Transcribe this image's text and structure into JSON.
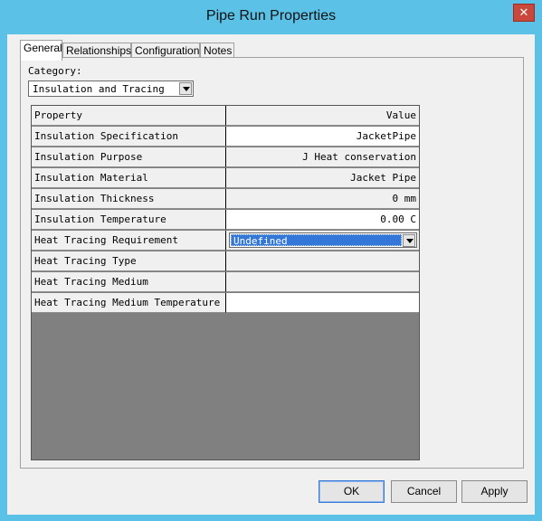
{
  "window": {
    "title": "Pipe Run Properties",
    "close_glyph": "✕"
  },
  "tabs": [
    {
      "label": "General"
    },
    {
      "label": "Relationships"
    },
    {
      "label": "Configuration"
    },
    {
      "label": "Notes"
    }
  ],
  "category": {
    "label": "Category:",
    "selected": "Insulation and Tracing"
  },
  "grid": {
    "header": {
      "property": "Property",
      "value": "Value"
    },
    "rows": [
      {
        "name": "Insulation Specification",
        "value": "JacketPipe"
      },
      {
        "name": "Insulation Purpose",
        "value": "J Heat conservation"
      },
      {
        "name": "Insulation Material",
        "value": "Jacket Pipe"
      },
      {
        "name": "Insulation Thickness",
        "value": "0 mm"
      },
      {
        "name": "Insulation Temperature",
        "value": "0.00 C"
      },
      {
        "name": "Heat Tracing Requirement",
        "value": "Undefined"
      },
      {
        "name": "Heat Tracing Type",
        "value": ""
      },
      {
        "name": "Heat Tracing Medium",
        "value": ""
      },
      {
        "name": "Heat Tracing Medium Temperature",
        "value": ""
      }
    ]
  },
  "buttons": {
    "ok": "OK",
    "cancel": "Cancel",
    "apply": "Apply"
  },
  "colors": {
    "title_bar": "#5bc1e6",
    "selection": "#3378d8",
    "grid_empty": "#808080"
  }
}
